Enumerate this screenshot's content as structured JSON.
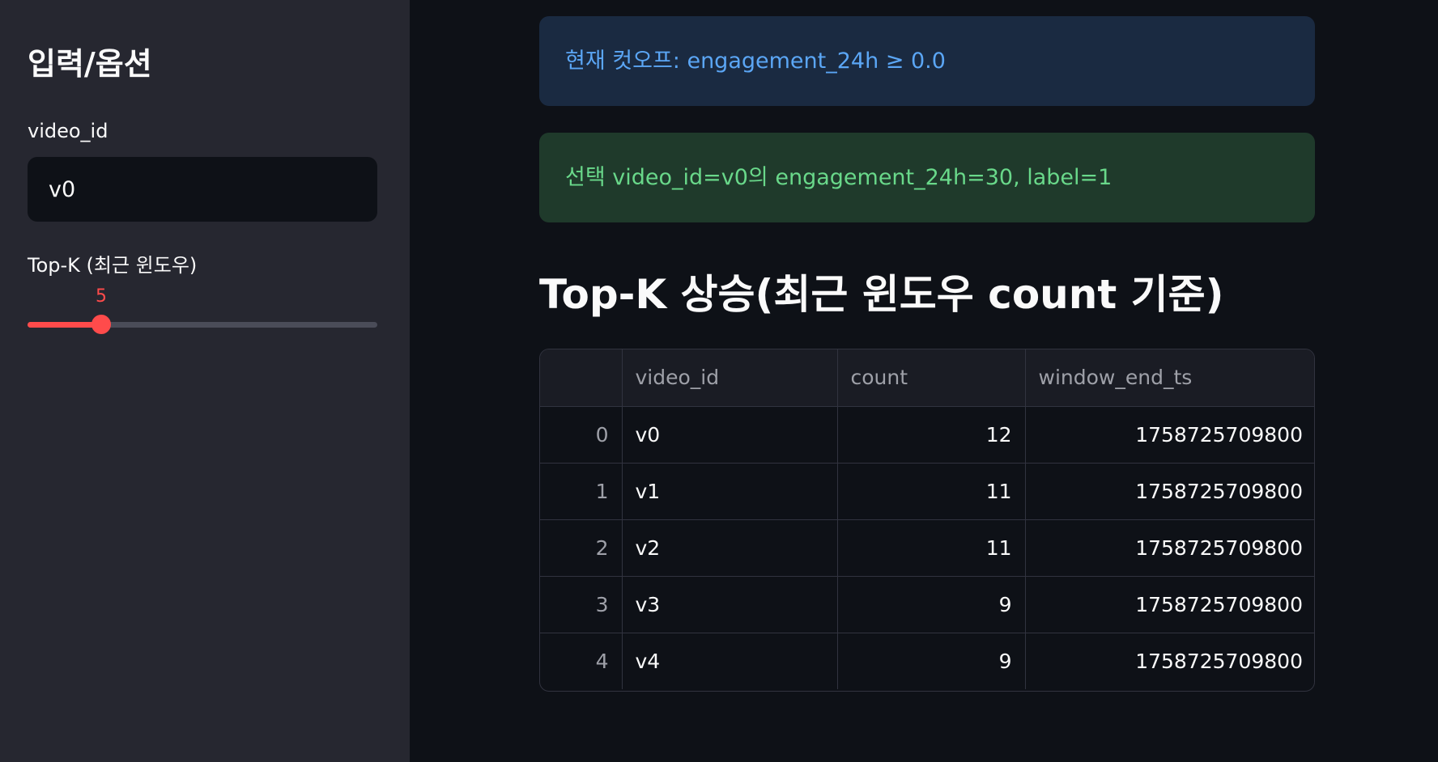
{
  "sidebar": {
    "title": "입력/옵션",
    "video_id_label": "video_id",
    "video_id_value": "v0",
    "topk_label": "Top-K (최근 윈도우)",
    "topk_value": "5",
    "topk_fraction": 0.21
  },
  "main": {
    "info_alert": "현재 컷오프: engagement_24h ≥ 0.0",
    "success_alert": "선택 video_id=v0의 engagement_24h=30, label=1",
    "section_title": "Top-K 상승(최근 윈도우 count 기준)",
    "table": {
      "columns": [
        "",
        "video_id",
        "count",
        "window_end_ts"
      ],
      "rows": [
        {
          "index": "0",
          "video_id": "v0",
          "count": "12",
          "window_end_ts": "1758725709800"
        },
        {
          "index": "1",
          "video_id": "v1",
          "count": "11",
          "window_end_ts": "1758725709800"
        },
        {
          "index": "2",
          "video_id": "v2",
          "count": "11",
          "window_end_ts": "1758725709800"
        },
        {
          "index": "3",
          "video_id": "v3",
          "count": "9",
          "window_end_ts": "1758725709800"
        },
        {
          "index": "4",
          "video_id": "v4",
          "count": "9",
          "window_end_ts": "1758725709800"
        }
      ]
    }
  },
  "colors": {
    "accent": "#ff4b4b",
    "info_text": "#5ba6f5",
    "success_text": "#69d88a",
    "background": "#0e1117",
    "sidebar_bg": "#262730"
  }
}
